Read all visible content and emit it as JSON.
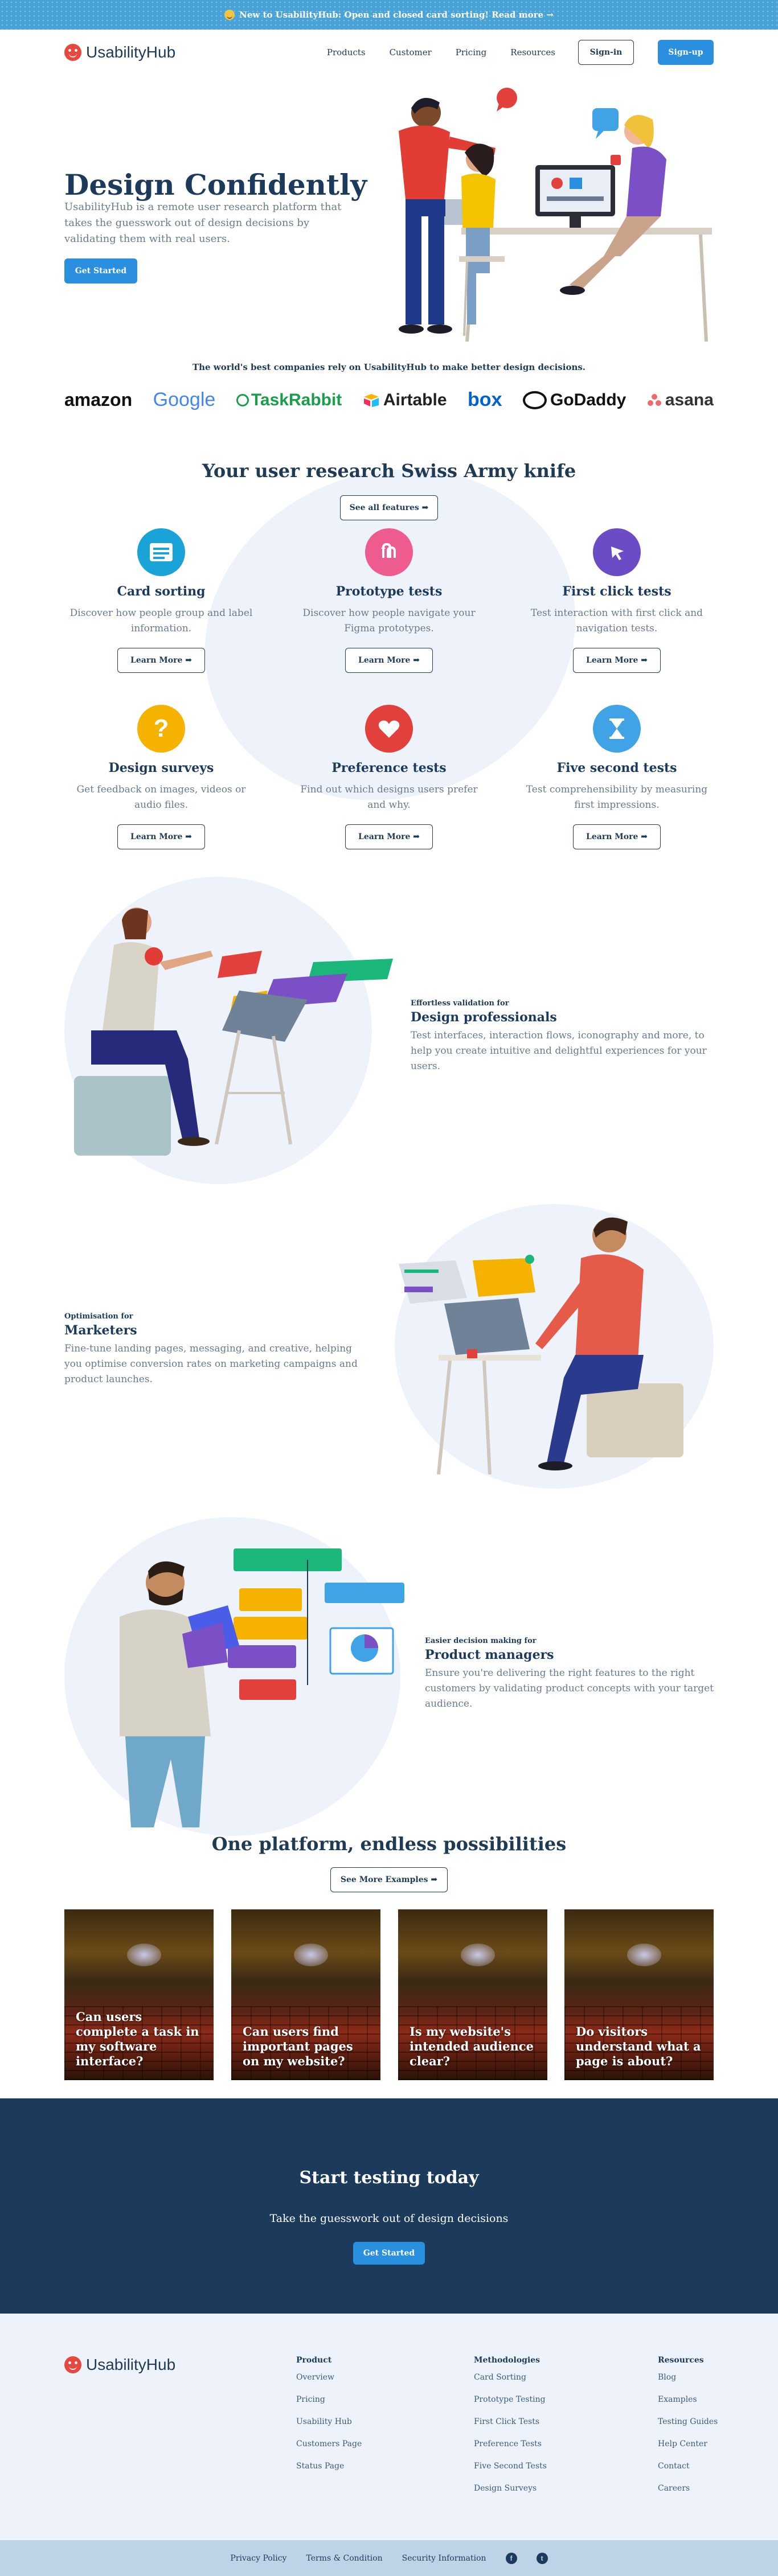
{
  "banner": {
    "text": "New to UsabilityHub: Open and closed card sorting! Read more →"
  },
  "nav": {
    "logo": "UsabilityHub",
    "links": [
      "Products",
      "Customer",
      "Pricing",
      "Resources"
    ],
    "signin": "Sign-in",
    "signup": "Sign-up"
  },
  "hero": {
    "title": "Design Confidently",
    "text": "UsabilityHub is a remote user research platform that takes the guesswork out of design decisions by validating them with real users.",
    "cta": "Get Started"
  },
  "logos": {
    "title": "The world's best companies rely on UsabilityHub to make better design decisions.",
    "items": [
      "amazon",
      "Google",
      "TaskRabbit",
      "Airtable",
      "box",
      "GoDaddy",
      "asana"
    ]
  },
  "features": {
    "title": "Your user research Swiss Army knife",
    "all_button": "See all features ➡",
    "learn_more": "Learn More ➡",
    "items": [
      {
        "title": "Card sorting",
        "text": "Discover how people group and label information.",
        "icon": "card-sorting-icon",
        "color": "#1aa3d6"
      },
      {
        "title": "Prototype tests",
        "text": "Discover how people navigate your Figma prototypes.",
        "icon": "prototype-icon",
        "color": "#ee5c8f"
      },
      {
        "title": "First click tests",
        "text": "Test interaction with first click and navigation tests.",
        "icon": "cursor-icon",
        "color": "#6b4bc6"
      },
      {
        "title": "Design surveys",
        "text": "Get feedback on images, videos or audio files.",
        "icon": "question-icon",
        "color": "#f5b300"
      },
      {
        "title": "Preference tests",
        "text": "Find out which designs users prefer and why.",
        "icon": "heart-icon",
        "color": "#e2403c"
      },
      {
        "title": "Five second tests",
        "text": "Test comprehensibility by measuring first impressions.",
        "icon": "hourglass-icon",
        "color": "#3fa3e6"
      }
    ]
  },
  "personas": [
    {
      "kicker": "Effortless validation for",
      "title": "Design professionals",
      "text": "Test interfaces, interaction flows, iconography and more, to help you create intuitive and delightful experiences for your users."
    },
    {
      "kicker": "Optimisation for",
      "title": "Marketers",
      "text": "Fine-tune landing pages, messaging, and creative, helping you optimise conversion rates on marketing campaigns and product launches."
    },
    {
      "kicker": "Easier decision making for",
      "title": "Product managers",
      "text": "Ensure you're delivering the right features to the right customers by validating product concepts with your target audience."
    }
  ],
  "examples": {
    "title": "One platform, endless possibilities",
    "more_button": "See More Examples ➡",
    "items": [
      "Can users complete a task in my software interface?",
      "Can users find important pages on my website?",
      "Is my website's intended audience clear?",
      "Do visitors understand what a page is about?"
    ]
  },
  "cta": {
    "title": "Start testing today",
    "text": "Take the guesswork out of design decisions",
    "button": "Get Started"
  },
  "footer": {
    "logo": "UsabilityHub",
    "columns": [
      {
        "title": "Product",
        "links": [
          "Overview",
          "Pricing",
          "Usability Hub",
          "Customers Page",
          "Status Page"
        ]
      },
      {
        "title": "Methodologies",
        "links": [
          "Card Sorting",
          "Prototype Testing",
          "First Click Tests",
          "Preference Tests",
          "Five Second Tests",
          "Design Surveys"
        ]
      },
      {
        "title": "Resources",
        "links": [
          "Blog",
          "Examples",
          "Testing Guides",
          "Help Center",
          "Contact",
          "Careers"
        ]
      }
    ],
    "bottom_links": [
      "Privacy Policy",
      "Terms & Condition",
      "Security Information"
    ]
  },
  "colors": {
    "primary": "#2b8fe0",
    "navy": "#1b3a5c",
    "light_bg": "#eef3fb"
  }
}
